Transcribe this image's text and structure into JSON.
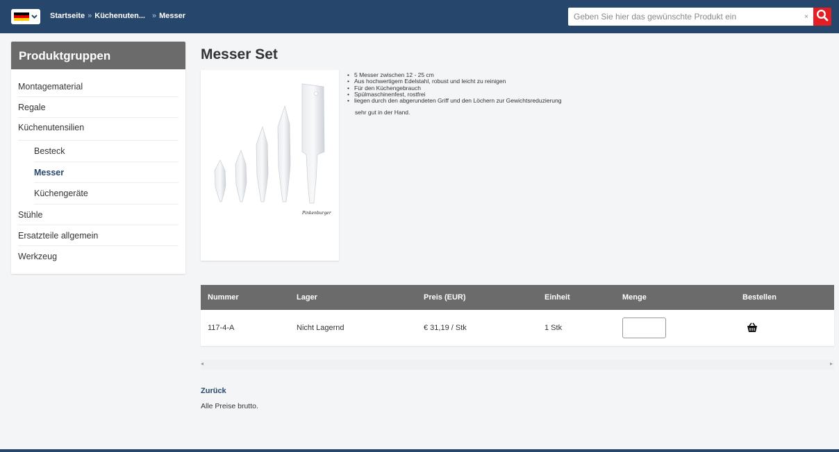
{
  "header": {
    "language_flag": "de",
    "breadcrumb": {
      "home": "Startseite",
      "category": "Küchenuten...",
      "current": "Messer",
      "separator": "»"
    },
    "search": {
      "value": "",
      "placeholder": "Geben Sie hier das gewünschte Produkt ein",
      "clear_label": "×",
      "button_icon": "search-icon"
    }
  },
  "sidebar": {
    "title": "Produktgruppen",
    "items": [
      {
        "label": "Montagematerial",
        "level": 0,
        "active": false
      },
      {
        "label": "Regale",
        "level": 0,
        "active": false
      },
      {
        "label": "Küchenutensilien",
        "level": 0,
        "active": false
      },
      {
        "label": "Besteck",
        "level": 1,
        "active": false
      },
      {
        "label": "Messer",
        "level": 1,
        "active": true
      },
      {
        "label": "Küchengeräte",
        "level": 1,
        "active": false
      },
      {
        "label": "Stühle",
        "level": 0,
        "active": false
      },
      {
        "label": "Ersatzteile allgemein",
        "level": 0,
        "active": false
      },
      {
        "label": "Werkzeug",
        "level": 0,
        "active": false
      }
    ]
  },
  "product": {
    "title": "Messer Set",
    "image_signature": "Pinkenburger",
    "features": [
      "5 Messer zwischen 12 - 25 cm",
      "Aus hochwertigem Edelstahl, robust und leicht zu reinigen",
      "Für den Küchengebrauch",
      "Spülmaschinenfest, rostfrei",
      "liegen durch den abgerundeten Griff und den Löchern zur Gewichtsreduzierung"
    ],
    "extra_text": "sehr gut in der Hand."
  },
  "table": {
    "headers": [
      "Nummer",
      "Lager",
      "Preis (EUR)",
      "Einheit",
      "Menge",
      "Bestellen"
    ],
    "rows": [
      {
        "nummer": "117-4-A",
        "lager": "Nicht Lagernd",
        "preis": "€  31,19 / Stk",
        "einheit": "1 Stk",
        "menge": "",
        "order_icon": "basket-icon"
      }
    ]
  },
  "footer": {
    "back_label": "Zurück",
    "price_note": "Alle Preise brutto."
  },
  "colors": {
    "brand_blue": "#26476b",
    "search_red": "#e31e24",
    "header_gray": "#6b6b6b"
  }
}
